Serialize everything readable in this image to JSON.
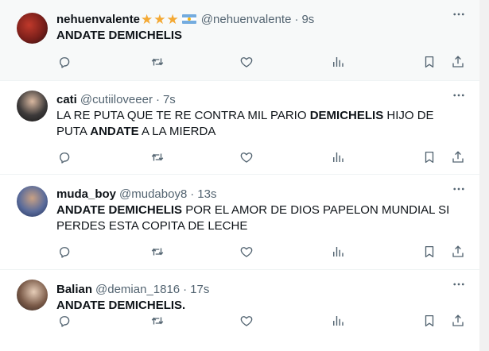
{
  "tweets": [
    {
      "display_name": "nehuenvalente",
      "badges": [
        "star-icon",
        "star-icon",
        "star-icon",
        "argentina-flag-icon"
      ],
      "handle": "@nehuenvalente",
      "separator": "·",
      "time": "9s",
      "body_segments": [
        {
          "text": "ANDATE DEMICHELIS",
          "bold": true
        }
      ]
    },
    {
      "display_name": "cati",
      "handle": "@cutiiloveeer",
      "separator": "·",
      "time": "7s",
      "body_segments": [
        {
          "text": "LA RE PUTA QUE TE RE CONTRA MIL PARIO ",
          "bold": false
        },
        {
          "text": "DEMICHELIS",
          "bold": true
        },
        {
          "text": " HIJO DE PUTA ",
          "bold": false
        },
        {
          "text": "ANDATE",
          "bold": true
        },
        {
          "text": " A LA MIERDA",
          "bold": false
        }
      ]
    },
    {
      "display_name": "muda_boy",
      "handle": "@mudaboy8",
      "separator": "·",
      "time": "13s",
      "body_segments": [
        {
          "text": "ANDATE DEMICHELIS",
          "bold": true
        },
        {
          "text": " POR EL AMOR DE DIOS PAPELON MUNDIAL SI PERDES ESTA COPITA DE LECHE",
          "bold": false
        }
      ]
    },
    {
      "display_name": "Balian",
      "handle": "@demian_1816",
      "separator": "·",
      "time": "17s",
      "body_segments": [
        {
          "text": "ANDATE DEMICHELIS.",
          "bold": true
        }
      ]
    }
  ],
  "icons": {
    "more": "more-horizontal-icon",
    "reply": "reply-icon",
    "retweet": "retweet-icon",
    "like": "heart-icon",
    "views": "views-bar-chart-icon",
    "bookmark": "bookmark-icon",
    "share": "share-icon"
  },
  "colors": {
    "text": "#0f1419",
    "secondary": "#536471",
    "divider": "#eff3f4",
    "star": "#f4a934",
    "hover_bg": "#f7f9f9"
  }
}
